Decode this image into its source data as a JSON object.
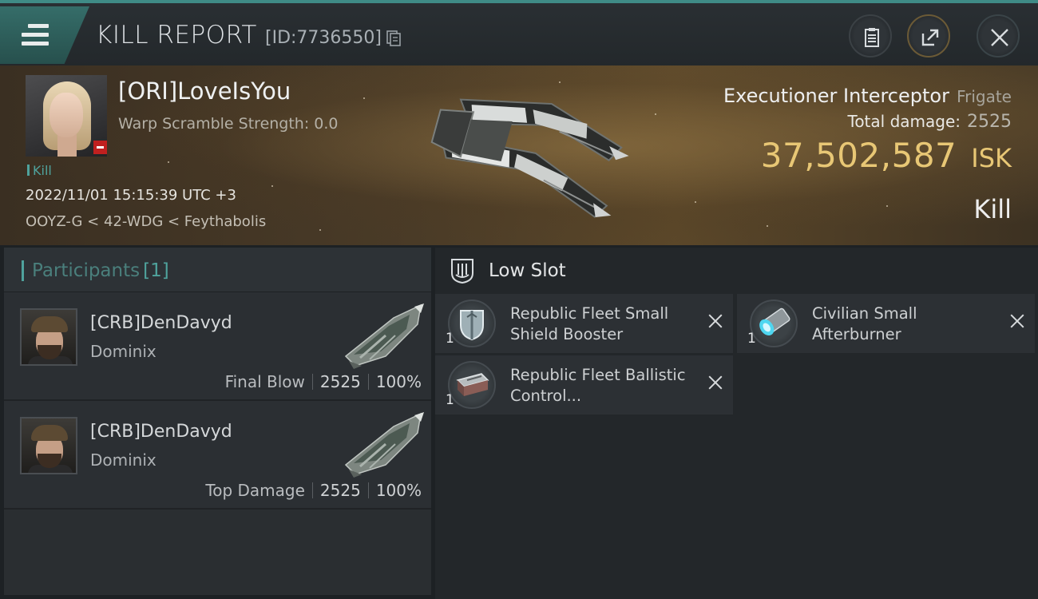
{
  "header": {
    "title": "KILL REPORT",
    "report_id": "[ID:7736550]",
    "icons": {
      "menu": "hamburger-menu-icon",
      "copy": "copy-icon",
      "report": "clipboard-icon",
      "share": "share-icon",
      "close": "close-icon"
    }
  },
  "victim": {
    "pilot_name": "[ORI]LoveIsYou",
    "warp_scramble": "Warp Scramble Strength: 0.0",
    "tag": "Kill",
    "timestamp": "2022/11/01 15:15:39 UTC +3",
    "location": "OOYZ-G < 42-WDG < Feythabolis",
    "ship_name": "Executioner Interceptor",
    "ship_class": "Frigate",
    "total_damage_label": "Total damage:",
    "total_damage": "2525",
    "isk_value": "37,502,587",
    "isk_unit": "ISK",
    "result": "Kill"
  },
  "participants": {
    "label": "Participants",
    "count": "[1]",
    "rows": [
      {
        "name": "[CRB]DenDavyd",
        "ship": "Dominix",
        "role": "Final Blow",
        "damage": "2525",
        "percent": "100%"
      },
      {
        "name": "[CRB]DenDavyd",
        "ship": "Dominix",
        "role": "Top Damage",
        "damage": "2525",
        "percent": "100%"
      }
    ]
  },
  "slots": {
    "title": "Low Slot",
    "modules": [
      {
        "name": "Republic Fleet Small Shield Booster",
        "qty": "1",
        "icon": "shield-booster-icon"
      },
      {
        "name": "Civilian Small Afterburner",
        "qty": "1",
        "icon": "afterburner-icon"
      },
      {
        "name": "Republic Fleet Ballistic Control...",
        "qty": "1",
        "icon": "ballistic-control-icon"
      }
    ]
  },
  "colors": {
    "accent": "#4fa39d",
    "isk": "#e8c775",
    "danger": "#c0201f"
  }
}
